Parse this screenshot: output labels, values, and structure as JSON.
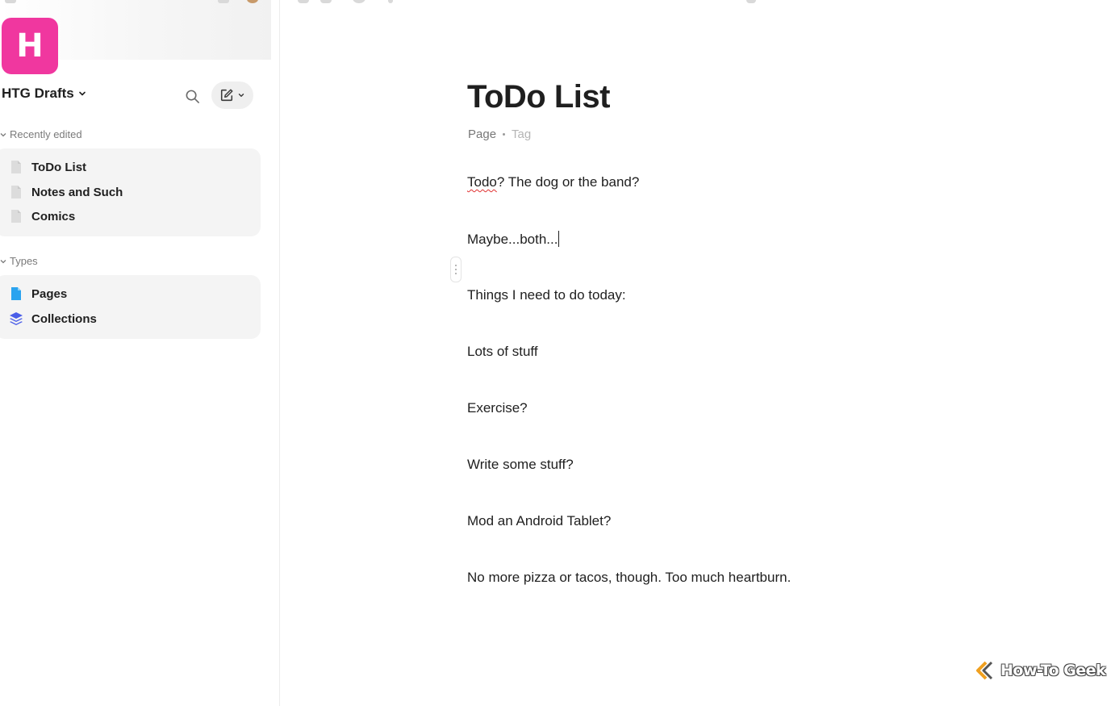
{
  "sidebar": {
    "space_initial": "H",
    "space_name": "HTG Drafts",
    "recent_section": {
      "label": "Recently edited",
      "items": [
        {
          "label": "ToDo List",
          "icon": "page-icon"
        },
        {
          "label": "Notes and Such",
          "icon": "page-icon"
        },
        {
          "label": "Comics",
          "icon": "page-icon"
        }
      ]
    },
    "types_section": {
      "label": "Types",
      "items": [
        {
          "label": "Pages",
          "icon": "page-icon"
        },
        {
          "label": "Collections",
          "icon": "layers-icon"
        }
      ]
    }
  },
  "editor": {
    "title": "ToDo List",
    "object_type": "Page",
    "tag_placeholder": "Tag",
    "blocks": [
      {
        "misspelled": "Todo",
        "text": "? The dog or the band?"
      },
      {
        "text": "Maybe...both..."
      },
      {
        "text": "Things I need to do today:"
      },
      {
        "text": "Lots of stuff"
      },
      {
        "text": "Exercise?"
      },
      {
        "text": "Write some stuff?"
      },
      {
        "text": "Mod an Android Tablet?"
      },
      {
        "text": "No more pizza or tacos, though. Too much heartburn."
      }
    ]
  },
  "watermark": {
    "text": "How-To Geek"
  },
  "colors": {
    "space_avatar": "#f0379f",
    "pages_icon": "#2aa3ef",
    "collections_icon": "#4a5ee8",
    "spellcheck": "#e03131"
  }
}
